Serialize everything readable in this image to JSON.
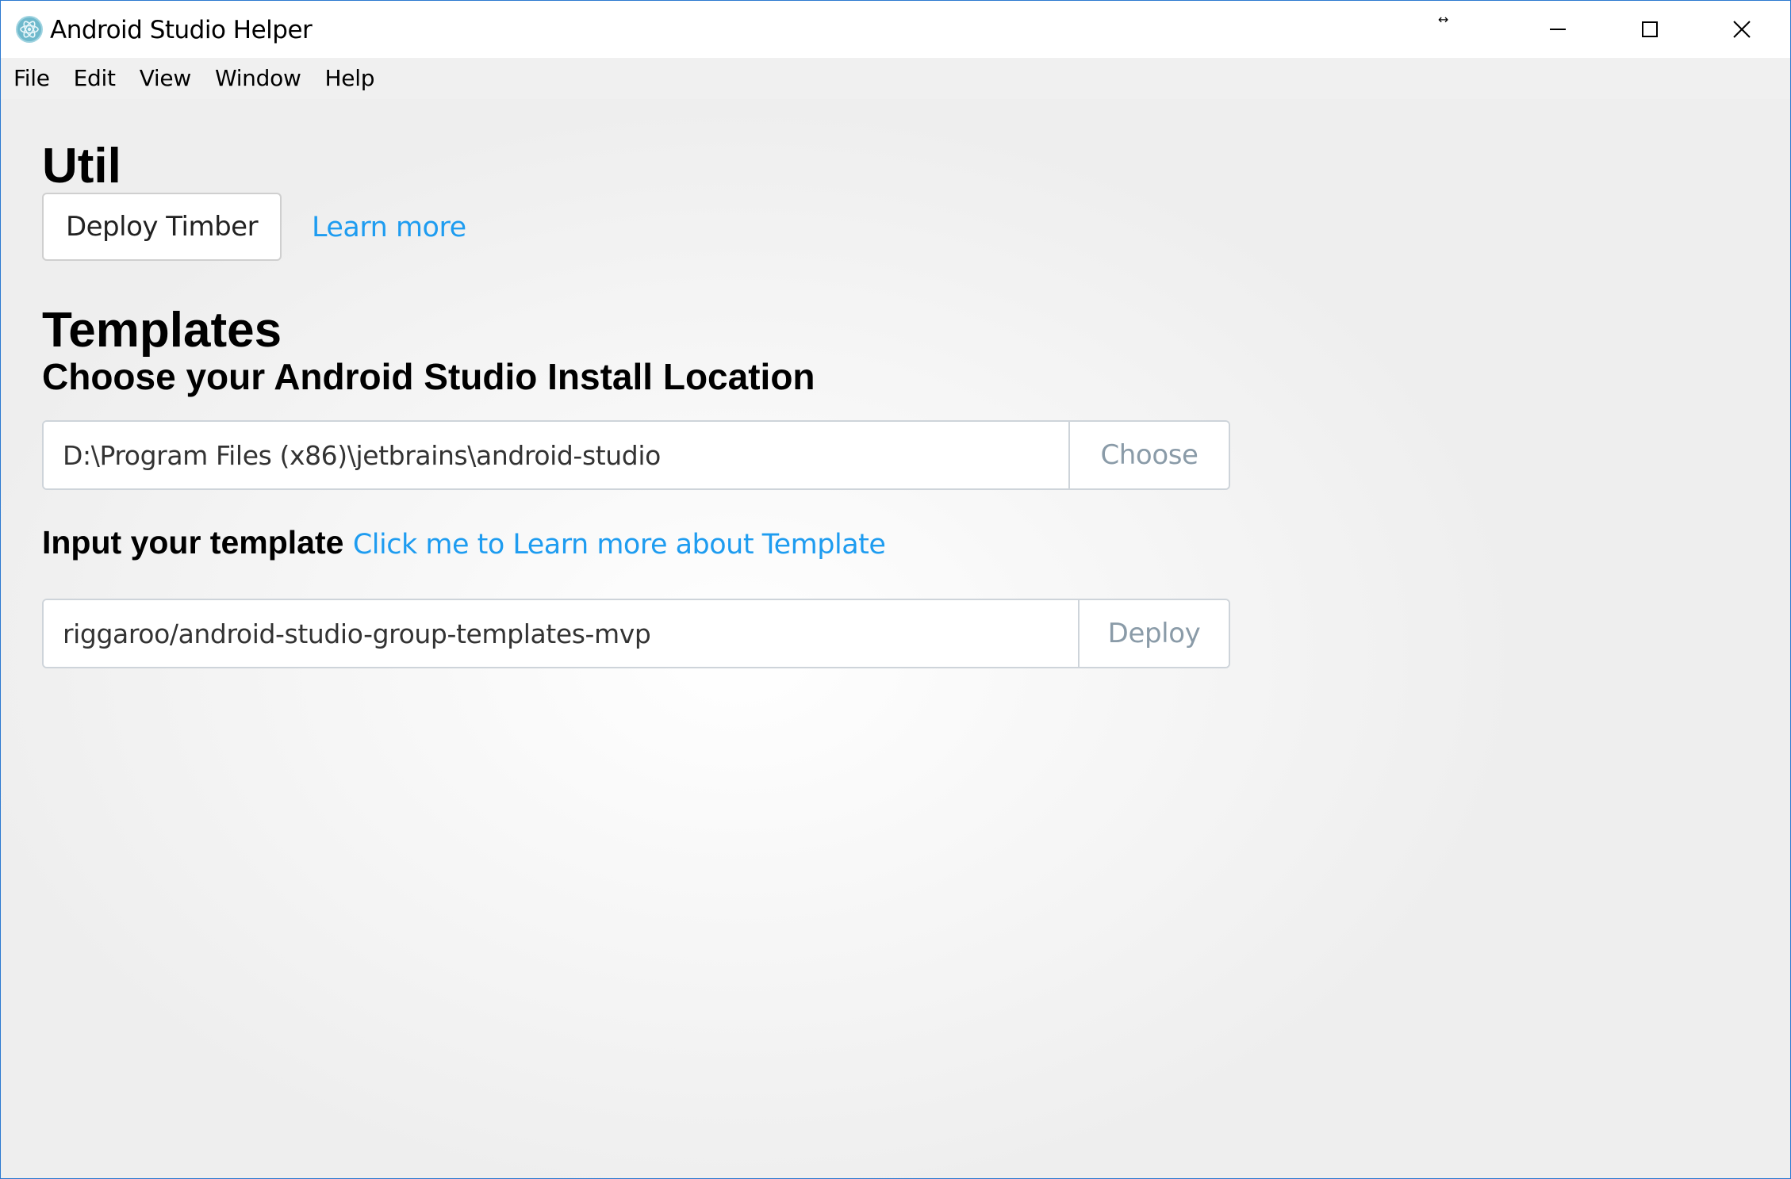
{
  "window": {
    "title": "Android Studio Helper",
    "resize_glyph": "↔",
    "controls": [
      "minimize-icon",
      "maximize-icon",
      "close-icon"
    ]
  },
  "menu": {
    "items": [
      "File",
      "Edit",
      "View",
      "Window",
      "Help"
    ]
  },
  "util": {
    "heading": "Util",
    "deploy_timber_label": "Deploy Timber",
    "learn_more_label": "Learn more"
  },
  "templates": {
    "heading": "Templates",
    "subheading": "Choose your Android Studio Install Location",
    "install_path_value": "D:\\Program Files (x86)\\jetbrains\\android-studio",
    "choose_label": "Choose",
    "input_label": "Input your template",
    "learn_template_link": "Click me to Learn more about Template",
    "template_value": "riggaroo/android-studio-group-templates-mvp",
    "deploy_label": "Deploy"
  },
  "colors": {
    "link": "#1e9cf0",
    "window_border": "#2b79d0",
    "addon_text": "#8a9ba8",
    "menu_bg": "#f0f0f0"
  }
}
